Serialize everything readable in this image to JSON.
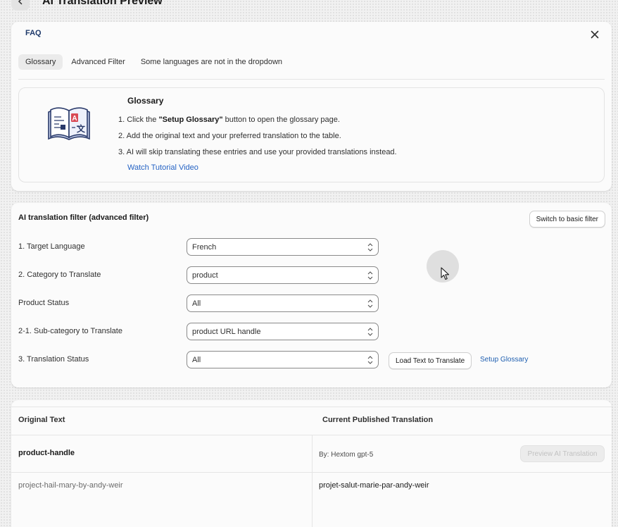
{
  "header": {
    "title": "AI Translation Preview"
  },
  "faq": {
    "title": "FAQ",
    "tabs": [
      {
        "label": "Glossary",
        "active": true
      },
      {
        "label": "Advanced Filter",
        "active": false
      },
      {
        "label": "Some languages are not in the dropdown",
        "active": false
      }
    ],
    "glossary": {
      "heading": "Glossary",
      "step1_prefix": "1. Click the ",
      "step1_bold": "\"Setup Glossary\"",
      "step1_suffix": " button to open the glossary page.",
      "step2": "2. Add the original text and your preferred translation to the table.",
      "step3": "3. AI will skip translating these entries and use your provided translations instead.",
      "link": "Watch Tutorial Video"
    }
  },
  "filter": {
    "title": "AI translation filter (advanced filter)",
    "basic_button": "Switch to basic filter",
    "rows": [
      {
        "label": "1. Target Language",
        "value": "French"
      },
      {
        "label": "2. Category to Translate",
        "value": "product"
      },
      {
        "label": "Product Status",
        "value": "All"
      },
      {
        "label": "2-1. Sub-category to Translate",
        "value": "product URL handle"
      },
      {
        "label": "3. Translation Status",
        "value": "All"
      }
    ],
    "load_button": "Load Text to Translate",
    "setup_link": "Setup Glossary"
  },
  "table": {
    "col_original": "Original Text",
    "col_current": "Current Published Translation",
    "group_name": "product-handle",
    "by_label": "By: Hextom gpt-5",
    "preview_button": "Preview AI Translation",
    "rows": [
      {
        "original": "project-hail-mary-by-andy-weir",
        "translation": "projet-salut-marie-par-andy-weir"
      }
    ]
  },
  "colors": {
    "link": "#2563c4",
    "text": "#303030",
    "border": "#8a8a8a"
  }
}
